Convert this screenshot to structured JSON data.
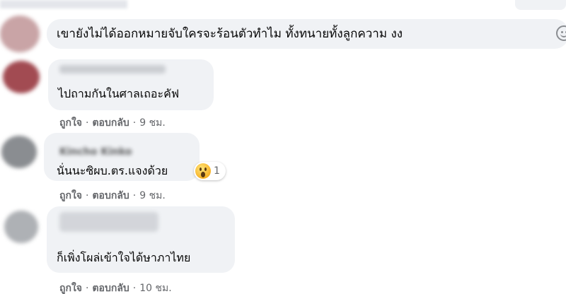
{
  "composer": {
    "text": "เขายังไม่ได้ออกหมายจับใครจะร้อนตัวทำไม ทั้งทนายทั้งลูกความ งง",
    "emoji_icon": "smiley-icon"
  },
  "comments": [
    {
      "author": "",
      "text": "ไปถามกันในศาลเถอะคัฟ",
      "like_label": "ถูกใจ",
      "reply_label": "ตอบกลับ",
      "separator": "·",
      "time": "9 ชม."
    },
    {
      "author": "Kincho Kinko",
      "text": "นั่นนะซิผบ.ตร.แจงด้วย",
      "like_label": "ถูกใจ",
      "reply_label": "ตอบกลับ",
      "separator": "·",
      "time": "9 ชม.",
      "reaction": {
        "icon": "wow-reaction-icon",
        "count": "1"
      }
    },
    {
      "author": "",
      "text": "ก็เพิ่งโผล่เข้าใจได้ษาภาไทย",
      "like_label": "ถูกใจ",
      "reply_label": "ตอบกลับ",
      "separator": "·",
      "time": "10 ชม."
    }
  ],
  "colors": {
    "bubble": "#f0f2f5",
    "action_text": "#65676b",
    "text": "#050505"
  }
}
